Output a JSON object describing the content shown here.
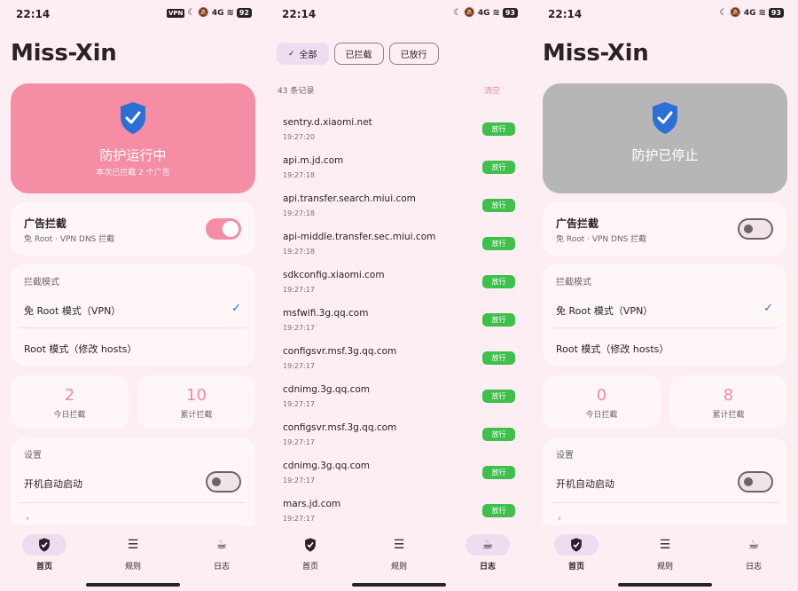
{
  "status": {
    "time": "22:14",
    "vpn": "VPN",
    "net": "4G",
    "battery_s1": "92",
    "battery_s2": "93",
    "battery_s3": "93"
  },
  "app_title": "Miss-Xin",
  "home_running": {
    "hero_title": "防护运行中",
    "hero_sub": "本次已拦截 2 个广告",
    "ad_title": "广告拦截",
    "ad_sub": "免 Root · VPN DNS 拦截",
    "ad_enabled": true,
    "mode_head": "拦截模式",
    "mode_vpn": "免 Root 模式（VPN）",
    "mode_root": "Root 模式（修改 hosts）",
    "today_num": "2",
    "today_label": "今日拦截",
    "total_num": "10",
    "total_label": "累计拦截",
    "settings_head": "设置",
    "autostart": "开机自动启动",
    "more": "›"
  },
  "home_stopped": {
    "hero_title": "防护已停止",
    "ad_title": "广告拦截",
    "ad_sub": "免 Root · VPN DNS 拦截",
    "ad_enabled": false,
    "mode_head": "拦截模式",
    "mode_vpn": "免 Root 模式（VPN）",
    "mode_root": "Root 模式（修改 hosts）",
    "today_num": "0",
    "today_label": "今日拦截",
    "total_num": "8",
    "total_label": "累计拦截",
    "settings_head": "设置",
    "autostart": "开机自动启动",
    "more": "›"
  },
  "log": {
    "chips": [
      "全部",
      "已拦截",
      "已放行"
    ],
    "chip_check": "✓",
    "count": "43 条记录",
    "clear": "清空",
    "entries": [
      {
        "domain": "sentry.d.xiaomi.net",
        "time": "19:27:20",
        "status": "放行"
      },
      {
        "domain": "api.m.jd.com",
        "time": "19:27:18",
        "status": "放行"
      },
      {
        "domain": "api.transfer.search.miui.com",
        "time": "19:27:18",
        "status": "放行"
      },
      {
        "domain": "api-middle.transfer.sec.miui.com",
        "time": "19:27:18",
        "status": "放行"
      },
      {
        "domain": "sdkconfig.xiaomi.com",
        "time": "19:27:17",
        "status": "放行"
      },
      {
        "domain": "msfwifi.3g.qq.com",
        "time": "19:27:17",
        "status": "放行"
      },
      {
        "domain": "configsvr.msf.3g.qq.com",
        "time": "19:27:17",
        "status": "放行"
      },
      {
        "domain": "cdnimg.3g.qq.com",
        "time": "19:27:17",
        "status": "放行"
      },
      {
        "domain": "configsvr.msf.3g.qq.com",
        "time": "19:27:17",
        "status": "放行"
      },
      {
        "domain": "cdnimg.3g.qq.com",
        "time": "19:27:17",
        "status": "放行"
      },
      {
        "domain": "mars.jd.com",
        "time": "19:27:17",
        "status": "放行"
      }
    ]
  },
  "nav": {
    "home": "首页",
    "rules": "规则",
    "logs": "日志"
  },
  "icons": {
    "shield": "shield-check-icon",
    "home": "shield-home-icon",
    "rules": "list-icon",
    "logs": "cup-icon"
  },
  "colors": {
    "accent_pink": "#f58da4",
    "stopped_gray": "#b6b6b6",
    "allow_green": "#3fbf4c",
    "shield_blue": "#2c6fd6",
    "nav_pill": "#eeddf0"
  }
}
